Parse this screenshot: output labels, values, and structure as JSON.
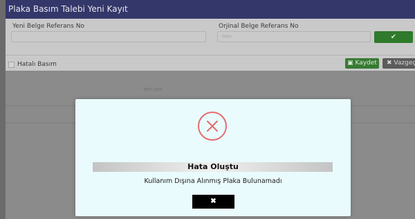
{
  "panel": {
    "title": "Plaka Basım Talebi Yeni Kayıt",
    "new_ref_label": "Yeni Belge Referans No",
    "new_ref_value": "",
    "orig_ref_label": "Orjinal Belge Referans No",
    "orig_ref_value": "•••••",
    "confirm_icon": "✔",
    "faulty_print_label": "Hatalı Basım",
    "save_label": "Kaydet",
    "save_icon": "🖹",
    "cancel_label": "Vazgeç",
    "cancel_icon": "✖"
  },
  "grid": {
    "empty_text": "Veri yok"
  },
  "modal": {
    "icon": "error-x-circle-icon",
    "title": "Hata Oluştu",
    "message": "Kullanım Dışına Alınmış Plaka Bulunamadı",
    "close_label": "✖"
  },
  "colors": {
    "header": "#34376a",
    "error_icon": "#e46d6d",
    "save": "#377a33",
    "modal_bg": "#eafbfd"
  }
}
